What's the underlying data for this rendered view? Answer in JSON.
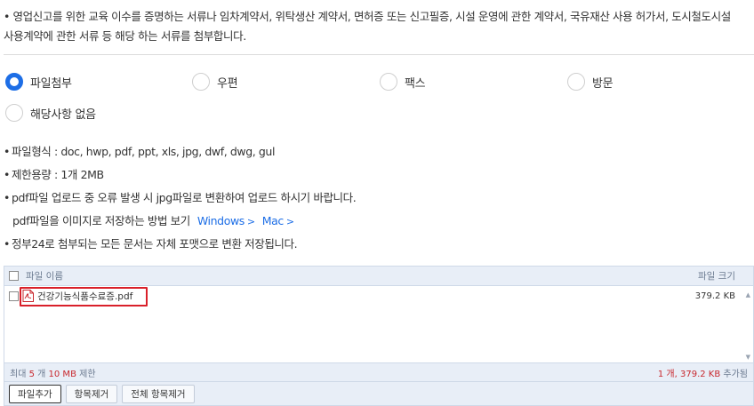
{
  "intro": {
    "line1": "• 영업신고를 위한 교육 이수를 증명하는 서류나 임차계약서, 위탁생산 계약서, 면허증 또는 신고필증, 시설 운영에 관한 계약서, 국유재산 사용 허가서, 도시철도시설",
    "line2": "사용계약에 관한 서류 등 해당 하는 서류를 첨부합니다."
  },
  "submission_methods": {
    "selected": "파일첨부",
    "options": [
      "파일첨부",
      "우편",
      "팩스",
      "방문",
      "해당사항 없음"
    ]
  },
  "notes": {
    "file_types": "파일형식 : doc, hwp, pdf, ppt, xls, jpg, dwf, dwg, gul",
    "size_limit": "제한용량 : 1개 2MB",
    "pdf_error": "pdf파일 업로드 중 오류 발생 시 jpg파일로 변환하여 업로드 하시기 바랍니다.",
    "pdf_save_howto": "pdf파일을 이미지로 저장하는 방법 보기",
    "link_windows": "Windows",
    "link_mac": "Mac",
    "link_chevron": ">",
    "conversion": "정부24로 첨부되는 모든 문서는 자체 포맷으로 변환 저장됩니다."
  },
  "file_table": {
    "header_name": "파일 이름",
    "header_size": "파일 크기",
    "files": [
      {
        "name": "건강기능식품수료증.pdf",
        "size": "379.2 KB"
      }
    ],
    "footer_prefix": "최대 ",
    "footer_count": "5",
    "footer_mid": " 개 ",
    "footer_mb": "10 MB",
    "footer_suffix": " 제한",
    "summary_count": "1",
    "summary_mid": " 개, ",
    "summary_size": "379.2 KB",
    "summary_suffix": " 추가됨"
  },
  "buttons": {
    "add": "파일추가",
    "remove": "항목제거",
    "remove_all": "전체 항목제거"
  },
  "colors": {
    "accent": "#1d6ee6",
    "highlight": "#d9202a",
    "panel": "#e8eef7"
  }
}
